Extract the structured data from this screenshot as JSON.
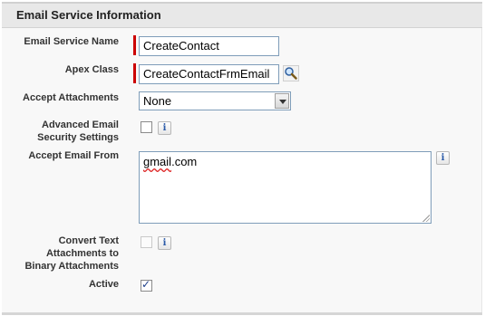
{
  "section": {
    "title": "Email Service Information"
  },
  "fields": {
    "email_service_name": {
      "label": "Email Service Name",
      "value": "CreateContact"
    },
    "apex_class": {
      "label": "Apex Class",
      "value": "CreateContactFrmEmail",
      "lookup_icon": "magnifier-icon"
    },
    "accept_attachments": {
      "label": "Accept Attachments",
      "selected": "None"
    },
    "advanced_security": {
      "label_line1": "Advanced Email",
      "label_line2": "Security Settings",
      "checked": false
    },
    "accept_email_from": {
      "label": "Accept Email From",
      "value_word": "gmail",
      "value_rest": ".com"
    },
    "convert_text": {
      "label_line1": "Convert Text",
      "label_line2": "Attachments to",
      "label_line3": "Binary Attachments",
      "checked": false,
      "disabled": true
    },
    "active": {
      "label": "Active",
      "checked": true
    }
  },
  "info_glyph": "i",
  "colors": {
    "required": "#cc0000",
    "header_bg": "#e8e8e8",
    "panel_bg": "#f8f8f8",
    "info_text": "#2a5aa8"
  }
}
